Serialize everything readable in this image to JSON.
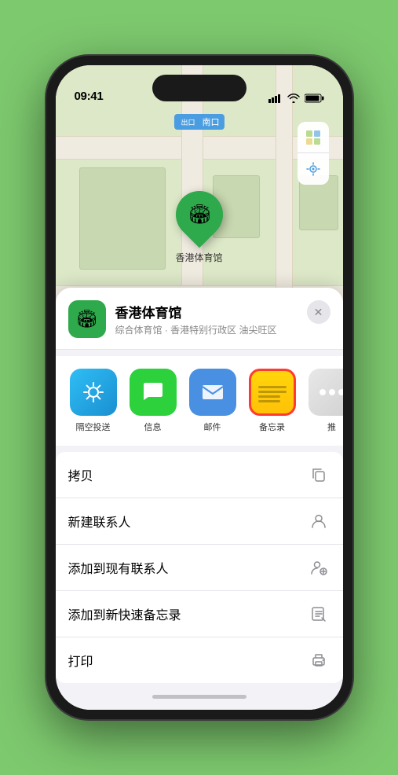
{
  "status_bar": {
    "time": "09:41",
    "time_icon": "▶"
  },
  "map": {
    "label": "南口",
    "pin_label": "香港体育馆",
    "btn_map": "🗺",
    "btn_location": "⬆"
  },
  "venue_header": {
    "name": "香港体育馆",
    "desc": "综合体育馆 · 香港特别行政区 油尖旺区",
    "close_label": "✕"
  },
  "share_items": [
    {
      "label": "隔空投送",
      "type": "airdrop"
    },
    {
      "label": "信息",
      "type": "messages"
    },
    {
      "label": "邮件",
      "type": "mail"
    },
    {
      "label": "备忘录",
      "type": "notes"
    },
    {
      "label": "推",
      "type": "more"
    }
  ],
  "actions": [
    {
      "label": "拷贝",
      "icon": "copy"
    },
    {
      "label": "新建联系人",
      "icon": "person"
    },
    {
      "label": "添加到现有联系人",
      "icon": "person-add"
    },
    {
      "label": "添加到新快速备忘录",
      "icon": "note"
    },
    {
      "label": "打印",
      "icon": "print"
    }
  ]
}
